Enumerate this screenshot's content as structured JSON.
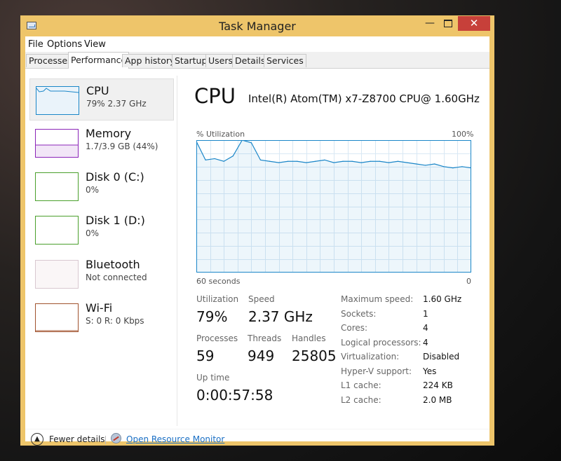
{
  "window": {
    "title": "Task Manager",
    "minimize": "—",
    "close": "✕"
  },
  "menu": [
    "File",
    "Options",
    "View"
  ],
  "tabs": [
    "Processes",
    "Performance",
    "App history",
    "Startup",
    "Users",
    "Details",
    "Services"
  ],
  "active_tab": "Performance",
  "sidebar": [
    {
      "title": "CPU",
      "subtitle": "79%  2.37 GHz",
      "color": "#1a86c8",
      "selected": true
    },
    {
      "title": "Memory",
      "subtitle": "1.7/3.9 GB (44%)",
      "color": "#8b24b8"
    },
    {
      "title": "Disk 0 (C:)",
      "subtitle": "0%",
      "color": "#4aa02c"
    },
    {
      "title": "Disk 1 (D:)",
      "subtitle": "0%",
      "color": "#4aa02c"
    },
    {
      "title": "Bluetooth",
      "subtitle": "Not connected",
      "color": "#c0a0b0"
    },
    {
      "title": "Wi-Fi",
      "subtitle": "S: 0  R: 0 Kbps",
      "color": "#a0522d"
    }
  ],
  "main": {
    "title": "CPU",
    "cpu_name": "Intel(R) Atom(TM) x7-Z8700 CPU@ 1.60GHz",
    "y_label": "% Utilization",
    "y_max": "100%",
    "x_left": "60 seconds",
    "x_right": "0"
  },
  "chart_data": {
    "type": "area",
    "x": [
      60,
      58,
      56,
      54,
      52,
      50,
      48,
      46,
      44,
      42,
      40,
      38,
      36,
      34,
      32,
      30,
      28,
      26,
      24,
      22,
      20,
      18,
      16,
      14,
      12,
      10,
      8,
      6,
      4,
      2,
      0
    ],
    "values": [
      99,
      85,
      86,
      84,
      88,
      100,
      98,
      85,
      84,
      83,
      84,
      84,
      83,
      84,
      85,
      83,
      84,
      84,
      83,
      84,
      84,
      83,
      84,
      83,
      82,
      81,
      82,
      80,
      79,
      80,
      79
    ],
    "ylim": [
      0,
      100
    ],
    "xlabel": "60 seconds",
    "ylabel": "% Utilization",
    "grid": true
  },
  "stats": {
    "utilization_label": "Utilization",
    "utilization": "79%",
    "speed_label": "Speed",
    "speed": "2.37 GHz",
    "processes_label": "Processes",
    "processes": "59",
    "threads_label": "Threads",
    "threads": "949",
    "handles_label": "Handles",
    "handles": "25805",
    "uptime_label": "Up time",
    "uptime": "0:00:57:58"
  },
  "specs": [
    {
      "label": "Maximum speed:",
      "value": "1.60 GHz"
    },
    {
      "label": "Sockets:",
      "value": "1"
    },
    {
      "label": "Cores:",
      "value": "4"
    },
    {
      "label": "Logical processors:",
      "value": "4"
    },
    {
      "label": "Virtualization:",
      "value": "Disabled"
    },
    {
      "label": "Hyper-V support:",
      "value": "Yes"
    },
    {
      "label": "L1 cache:",
      "value": "224 KB"
    },
    {
      "label": "L2 cache:",
      "value": "2.0 MB"
    }
  ],
  "footer": {
    "fewer_details": "Fewer details",
    "resource_monitor": "Open Resource Monitor"
  }
}
